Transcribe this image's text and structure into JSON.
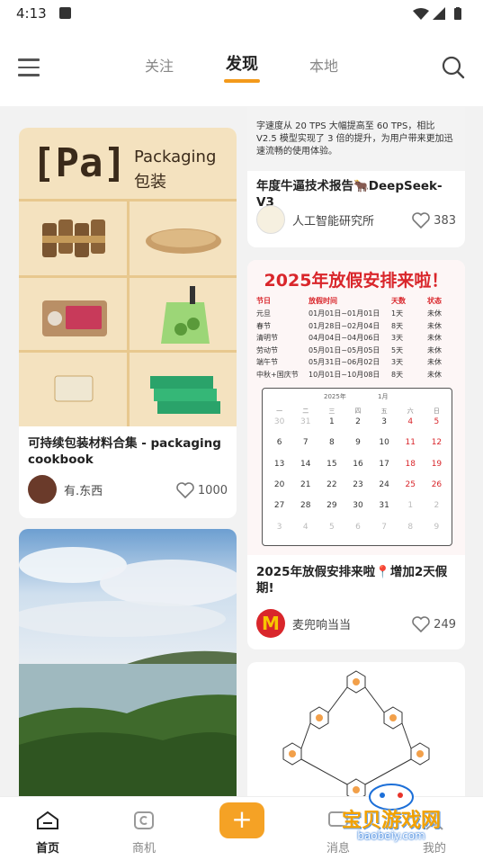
{
  "status_bar": {
    "time": "4:13",
    "app_badge": "A"
  },
  "header": {
    "tabs": [
      {
        "label": "关注"
      },
      {
        "label": "发现"
      },
      {
        "label": "本地"
      }
    ],
    "active_tab": "发现"
  },
  "feed": {
    "cards": [
      {
        "title": "可持续包装材料合集 - packaging cookbook",
        "image_text": {
          "logo": "[Pa]",
          "en": "Packaging",
          "zh": "包装"
        },
        "author": "有.东西",
        "likes": "1000"
      },
      {
        "top_snippet": "字速度从 20 TPS 大幅提高至 60 TPS，相比 V2.5 模型实现了 3 倍的提升，为用户带来更加迅速流畅的使用体验。",
        "title": "年度牛逼技术报告🐂DeepSeek-V3",
        "author": "人工智能研究所",
        "likes": "383"
      },
      {
        "image_title": "2025年放假安排来啦！",
        "table_headers": [
          "节日",
          "放假时间",
          "天数",
          "状态"
        ],
        "table_rows": [
          [
            "元旦",
            "01月01日~01月01日",
            "1天",
            "未休"
          ],
          [
            "春节",
            "01月28日~02月04日",
            "8天",
            "未休"
          ],
          [
            "清明节",
            "04月04日~04月06日",
            "3天",
            "未休"
          ],
          [
            "劳动节",
            "05月01日~05月05日",
            "5天",
            "未休"
          ],
          [
            "端午节",
            "05月31日~06月02日",
            "3天",
            "未休"
          ],
          [
            "中秋+国庆节",
            "10月01日~10月08日",
            "8天",
            "未休"
          ]
        ],
        "calendar": {
          "selector_year": "2025年",
          "selector_month": "1月",
          "weekday_labels": [
            "一",
            "二",
            "三",
            "四",
            "五",
            "六",
            "日"
          ],
          "days": [
            "30",
            "31",
            "1",
            "2",
            "3",
            "4",
            "5",
            "6",
            "7",
            "8",
            "9",
            "10",
            "11",
            "12",
            "13",
            "14",
            "15",
            "16",
            "17",
            "18",
            "19",
            "20",
            "21",
            "22",
            "23",
            "24",
            "25",
            "26",
            "27",
            "28",
            "29",
            "30",
            "31",
            "1",
            "2",
            "3",
            "4",
            "5",
            "6",
            "7",
            "8",
            "9"
          ]
        },
        "title": "2025年放假安排来啦📍增加2天假期!",
        "author": "麦兜响当当",
        "likes": "249"
      },
      {
        "image": "landscape-lake-photo"
      },
      {
        "image": "chemical-structure-diagram"
      }
    ]
  },
  "bottom_nav": {
    "items": [
      {
        "label": "首页"
      },
      {
        "label": "商机"
      },
      {
        "label": "+"
      },
      {
        "label": "消息"
      },
      {
        "label": "我的"
      }
    ]
  },
  "watermark": {
    "text": "宝贝游戏网",
    "url": "baobeiy.com"
  },
  "colors": {
    "accent": "#f39a1b",
    "red": "#d9262b"
  }
}
